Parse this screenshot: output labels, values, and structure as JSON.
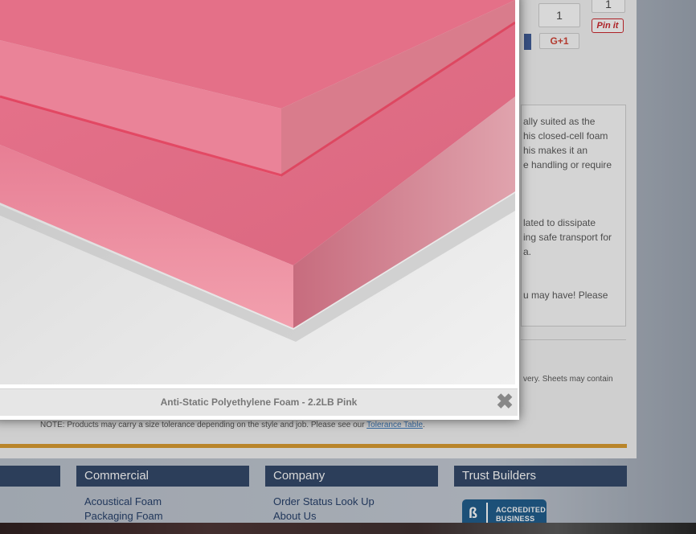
{
  "share": {
    "count_left": "1",
    "count_top": "1",
    "gplus_label": "G+1",
    "pinit_label": "Pin it"
  },
  "description_lines": [
    "ally suited as the",
    "his closed-cell foam",
    "his makes it an",
    "e handling or require",
    "lated to dissipate",
    "ing safe transport for",
    "a.",
    "u may have! Please"
  ],
  "sheets_note": "very. Sheets may contain",
  "tolerance_note": {
    "text": "NOTE: Products may carry a size tolerance depending on the style and job. Please see our ",
    "link": "Tolerance Table",
    "suffix": "."
  },
  "footer": {
    "commercial": {
      "heading": "Commercial",
      "links": [
        "Acoustical Foam",
        "Packaging Foam"
      ]
    },
    "company": {
      "heading": "Company",
      "links": [
        "Order Status Look Up",
        "About Us"
      ]
    },
    "trust": {
      "heading": "Trust Builders",
      "bbb_line1": "ACCREDITED",
      "bbb_line2": "BUSINESS"
    }
  },
  "lightbox": {
    "caption": "Anti-Static Polyethylene Foam - 2.2LB Pink",
    "close_glyph": "✖",
    "image_alt_icon": "product-photo"
  },
  "colors": {
    "foam_pink": "#e8708a",
    "footer_heading_bg": "#2e4466",
    "accent_orange": "#d99a2b"
  }
}
